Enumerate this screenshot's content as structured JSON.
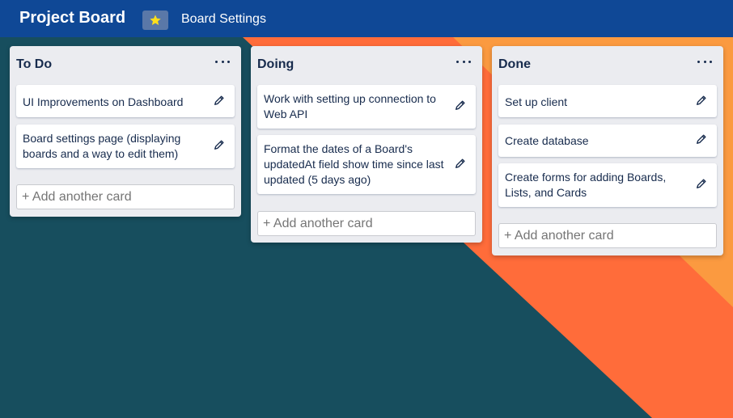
{
  "header": {
    "title": "Project Board",
    "star_icon": "star-icon",
    "settings_label": "Board Settings"
  },
  "colors": {
    "header_bg": "#0f4896",
    "background_teal": "#174e5e",
    "background_orange": "#ff6c3a",
    "background_light_orange": "#fb9a40",
    "star": "#ffe01a",
    "list_bg": "#ebecf0",
    "card_bg": "#ffffff"
  },
  "lists": [
    {
      "title": "To Do",
      "menu_icon": "more-horizontal-icon",
      "cards": [
        {
          "text": "UI Improvements on Dashboard",
          "icon": "pencil-icon"
        },
        {
          "text": "Board settings page (displaying boards and a way to edit them)",
          "icon": "pencil-icon"
        }
      ],
      "add_placeholder": "+ Add another card"
    },
    {
      "title": "Doing",
      "menu_icon": "more-horizontal-icon",
      "cards": [
        {
          "text": "Work with setting up connection to Web API",
          "icon": "pencil-icon"
        },
        {
          "text": "Format the dates of a Board's updatedAt field show time since last updated (5 days ago)",
          "icon": "pencil-icon"
        }
      ],
      "add_placeholder": "+ Add another card"
    },
    {
      "title": "Done",
      "menu_icon": "more-horizontal-icon",
      "cards": [
        {
          "text": "Set up client",
          "icon": "pencil-icon"
        },
        {
          "text": "Create database",
          "icon": "pencil-icon"
        },
        {
          "text": "Create forms for adding Boards, Lists, and Cards",
          "icon": "pencil-icon"
        }
      ],
      "add_placeholder": "+ Add another card"
    }
  ]
}
